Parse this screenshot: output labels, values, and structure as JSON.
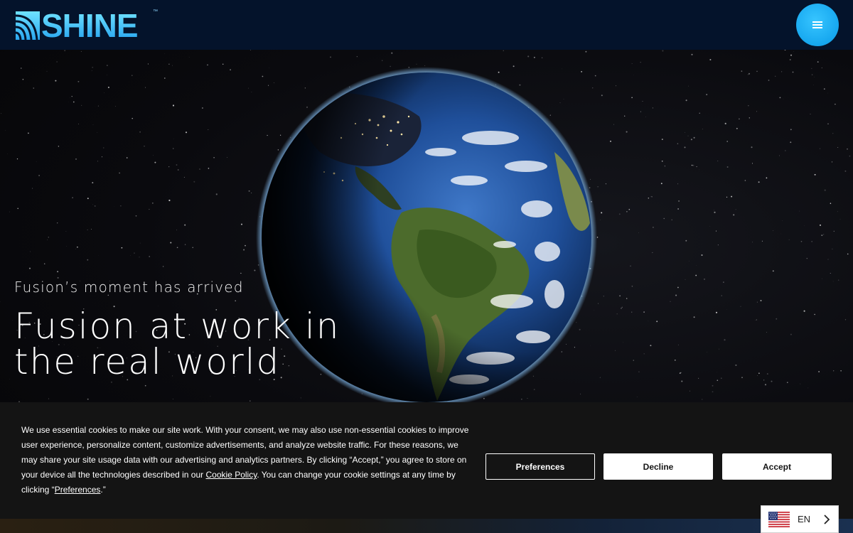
{
  "header": {
    "logo_text": "SHINE",
    "logo_tm": "™",
    "logo_icon": "shine-swoosh-icon",
    "menu_icon": "hamburger-menu-icon",
    "accent_color": "#16a7ef"
  },
  "hero": {
    "kicker": "Fusion’s moment has arrived",
    "headline": "Fusion at work in the real world",
    "image": "earth-from-space"
  },
  "cookie_banner": {
    "text_part1": "We use essential cookies to make our site work. With your consent, we may also use non-essential cookies to improve user experience, personalize content, customize advertisements, and analyze website traffic. For these reasons, we may share your site usage data with our advertising and analytics partners. By clicking “Accept,” you agree to store on your device all the technologies described in our ",
    "cookie_policy_link": "Cookie Policy",
    "text_part2": ". You can change your cookie settings at any time by clicking “",
    "preferences_link": "Preferences",
    "text_part3": ".”",
    "preferences_button": "Preferences",
    "decline_button": "Decline",
    "accept_button": "Accept"
  },
  "language_switcher": {
    "label": "EN",
    "flag_icon": "us-flag-icon",
    "chevron_icon": "chevron-right-icon"
  }
}
